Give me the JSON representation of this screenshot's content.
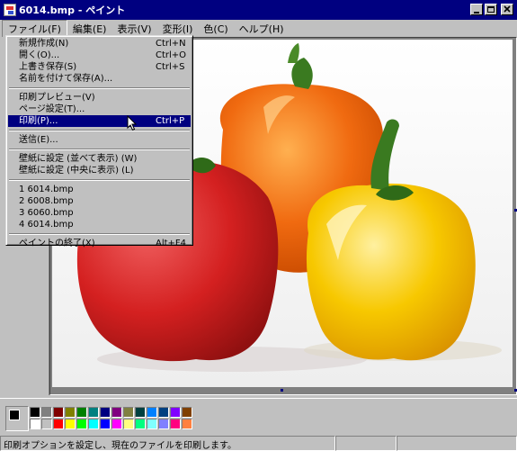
{
  "window": {
    "title": "6014.bmp - ペイント"
  },
  "menubar": {
    "items": [
      {
        "label": "ファイル(F)",
        "active": true
      },
      {
        "label": "編集(E)"
      },
      {
        "label": "表示(V)"
      },
      {
        "label": "変形(I)"
      },
      {
        "label": "色(C)"
      },
      {
        "label": "ヘルプ(H)"
      }
    ]
  },
  "file_menu": {
    "items": [
      {
        "label": "新規作成(N)",
        "shortcut": "Ctrl+N"
      },
      {
        "label": "開く(O)...",
        "shortcut": "Ctrl+O"
      },
      {
        "label": "上書き保存(S)",
        "shortcut": "Ctrl+S"
      },
      {
        "label": "名前を付けて保存(A)..."
      },
      {
        "separator": true
      },
      {
        "label": "印刷プレビュー(V)"
      },
      {
        "label": "ページ設定(T)..."
      },
      {
        "label": "印刷(P)...",
        "shortcut": "Ctrl+P",
        "highlighted": true
      },
      {
        "separator": true
      },
      {
        "label": "送信(E)..."
      },
      {
        "separator": true
      },
      {
        "label": "壁紙に設定 (並べて表示) (W)"
      },
      {
        "label": "壁紙に設定 (中央に表示) (L)"
      },
      {
        "separator": true
      },
      {
        "label": "1 6014.bmp"
      },
      {
        "label": "2 6008.bmp"
      },
      {
        "label": "3 6060.bmp"
      },
      {
        "label": "4 6014.bmp"
      },
      {
        "separator": true
      },
      {
        "label": "ペイントの終了(X)",
        "shortcut": "Alt+F4"
      }
    ]
  },
  "palette": {
    "primary": "#000000",
    "secondary": "#ffffff",
    "colors": [
      "#000000",
      "#808080",
      "#800000",
      "#808000",
      "#008000",
      "#008080",
      "#000080",
      "#800080",
      "#808040",
      "#004040",
      "#0080ff",
      "#004080",
      "#8000ff",
      "#804000",
      "#ffffff",
      "#c0c0c0",
      "#ff0000",
      "#ffff00",
      "#00ff00",
      "#00ffff",
      "#0000ff",
      "#ff00ff",
      "#ffff80",
      "#00ff80",
      "#80ffff",
      "#8080ff",
      "#ff0080",
      "#ff8040"
    ]
  },
  "status": {
    "message": "印刷オプションを設定し、現在のファイルを印刷します。"
  },
  "image": {
    "subject": "three bell peppers",
    "colors": {
      "red": "#d42020",
      "orange": "#f06a10",
      "yellow": "#f7c800",
      "stem": "#3a7a20"
    }
  }
}
